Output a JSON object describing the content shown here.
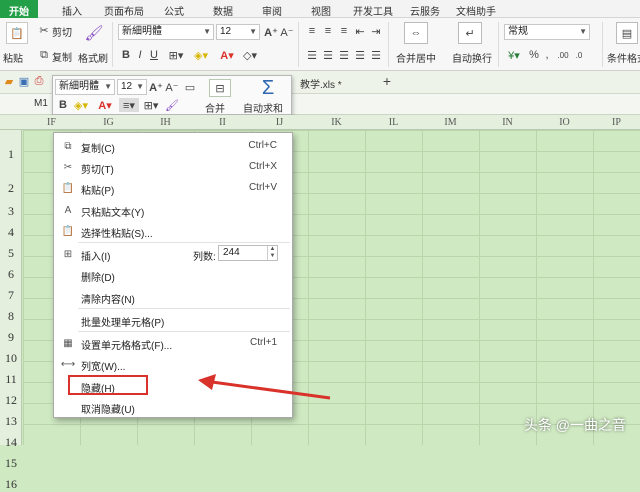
{
  "tabs": [
    "开始",
    "插入",
    "页面布局",
    "公式",
    "数据",
    "审阅",
    "视图",
    "开发工具",
    "云服务",
    "文档助手"
  ],
  "ribbon": {
    "cut": "剪切",
    "paste": "粘贴",
    "copy": "复制",
    "format_painter": "格式刷",
    "font_name": "新細明體",
    "font_size": "12",
    "merge_center": "合并居中",
    "wrap_text": "自动换行",
    "number_format": "常规",
    "percent": "%",
    "comma": ",",
    "conditional_format": "条件格式"
  },
  "doc_tab": "教学.xls *",
  "name_box": "M1",
  "mini_toolbar": {
    "font_name": "新細明體",
    "font_size": "12",
    "merge": "合并",
    "autosum": "自动求和"
  },
  "columns": [
    "IF",
    "IG",
    "IH",
    "II",
    "IJ",
    "IK",
    "IL",
    "IM",
    "IN",
    "IO",
    "IP"
  ],
  "rows": [
    "1",
    "2",
    "3",
    "4",
    "5",
    "6",
    "7",
    "8",
    "9",
    "10",
    "11",
    "12",
    "13",
    "14",
    "15",
    "16"
  ],
  "context_menu": {
    "copy": "复制(C)",
    "copy_sc": "Ctrl+C",
    "cut": "剪切(T)",
    "cut_sc": "Ctrl+X",
    "paste": "粘贴(P)",
    "paste_sc": "Ctrl+V",
    "paste_text": "只粘贴文本(Y)",
    "paste_special": "选择性粘贴(S)...",
    "insert": "插入(I)",
    "col_count_label": "列数:",
    "col_count": "244",
    "delete": "删除(D)",
    "clear": "清除内容(N)",
    "batch": "批量处理单元格(P)",
    "format_cells": "设置单元格格式(F)...",
    "format_cells_sc": "Ctrl+1",
    "col_width": "列宽(W)...",
    "hide": "隐藏(H)",
    "unhide": "取消隐藏(U)"
  },
  "watermark": "头条 @一曲之音",
  "colors": {
    "accent": "#23a047",
    "highlight": "#d9322a",
    "sheet": "#cfe9c2"
  }
}
